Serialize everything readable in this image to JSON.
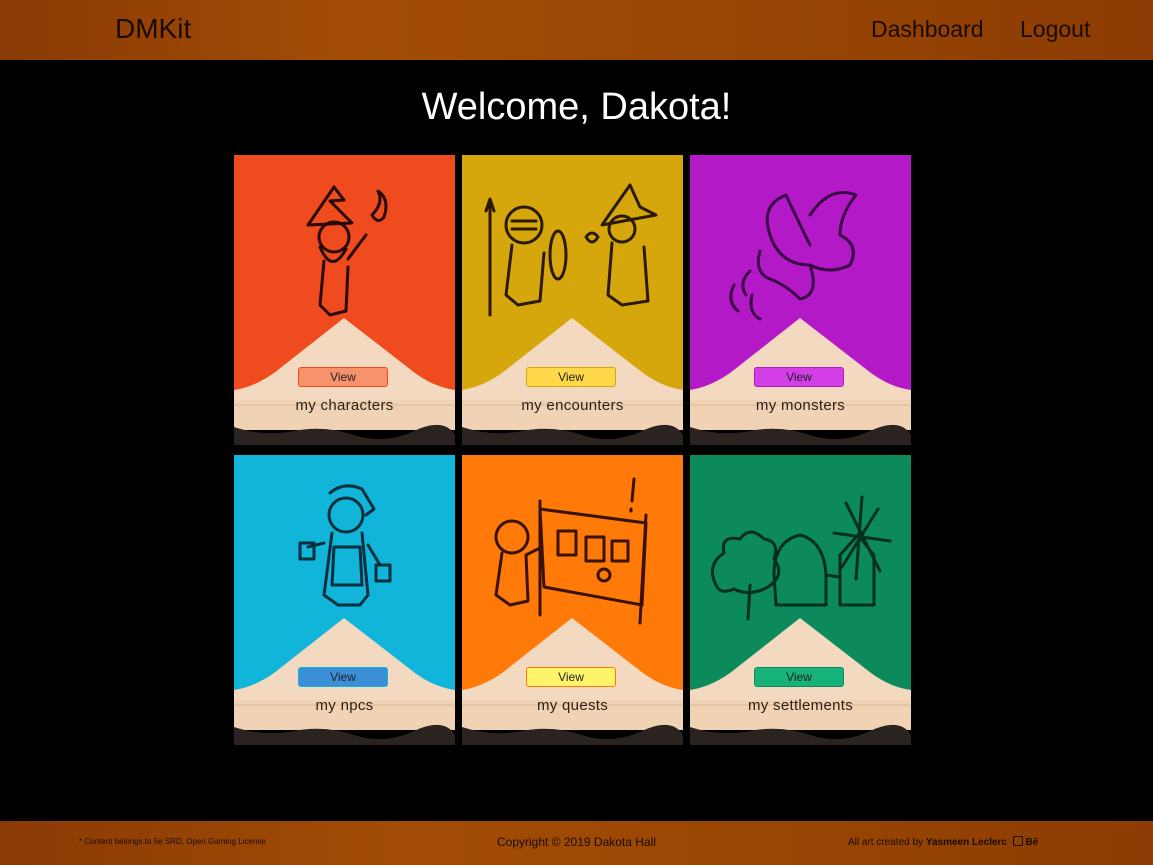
{
  "header": {
    "brand": "DMKit",
    "nav": {
      "dashboard": "Dashboard",
      "logout": "Logout"
    }
  },
  "welcome": "Welcome, Dakota!",
  "cards": [
    {
      "label": "my characters",
      "button": "View",
      "color": "#f04a1f",
      "button_color": "#f7936c",
      "icon": "wizard-icon"
    },
    {
      "label": "my encounters",
      "button": "View",
      "color": "#d6a70c",
      "button_color": "#ffd84a",
      "icon": "battle-icon"
    },
    {
      "label": "my monsters",
      "button": "View",
      "color": "#b419c8",
      "button_color": "#d43ee6",
      "icon": "dragon-icon"
    },
    {
      "label": "my npcs",
      "button": "View",
      "color": "#12b5da",
      "button_color": "#3a8fd6",
      "icon": "npc-icon"
    },
    {
      "label": "my quests",
      "button": "View",
      "color": "#ff7a08",
      "button_color": "#fff36a",
      "icon": "quest-board-icon"
    },
    {
      "label": "my settlements",
      "button": "View",
      "color": "#0c8a5b",
      "button_color": "#17b27a",
      "icon": "village-icon"
    }
  ],
  "footer": {
    "left": "* Content belongs to 5e SRD, Open Gaming License",
    "center": "Copyright © 2019 Dakota Hall",
    "right_prefix": "All art created by",
    "right_name": "Yasmeen Leclerc",
    "right_suffix": "Bē"
  }
}
